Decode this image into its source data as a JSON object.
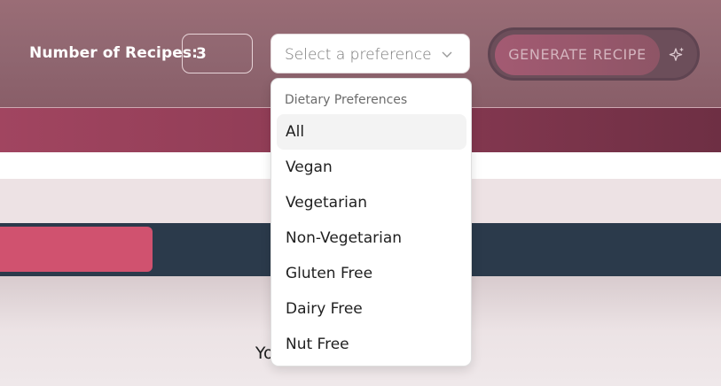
{
  "header": {
    "recipes_label": "Number of Recipes:",
    "recipes_value": "3",
    "select_placeholder": "Select a preference",
    "generate_label": "GENERATE RECIPE"
  },
  "dropdown": {
    "heading": "Dietary Preferences",
    "items": [
      "All",
      "Vegan",
      "Vegetarian",
      "Non-Vegetarian",
      "Gluten Free",
      "Dairy Free",
      "Nut Free"
    ],
    "highlighted": "All"
  },
  "main": {
    "placeholder_text": "Your s                        here"
  },
  "icons": {
    "select_chevron": "chevron-down-icon",
    "generate_sparkle": "sparkle-icon"
  },
  "colors": {
    "header_bg": "#946a73",
    "accent_pink": "#d0526f",
    "navy_band": "#2b3a4b",
    "rose_band": "#8e3c55"
  }
}
